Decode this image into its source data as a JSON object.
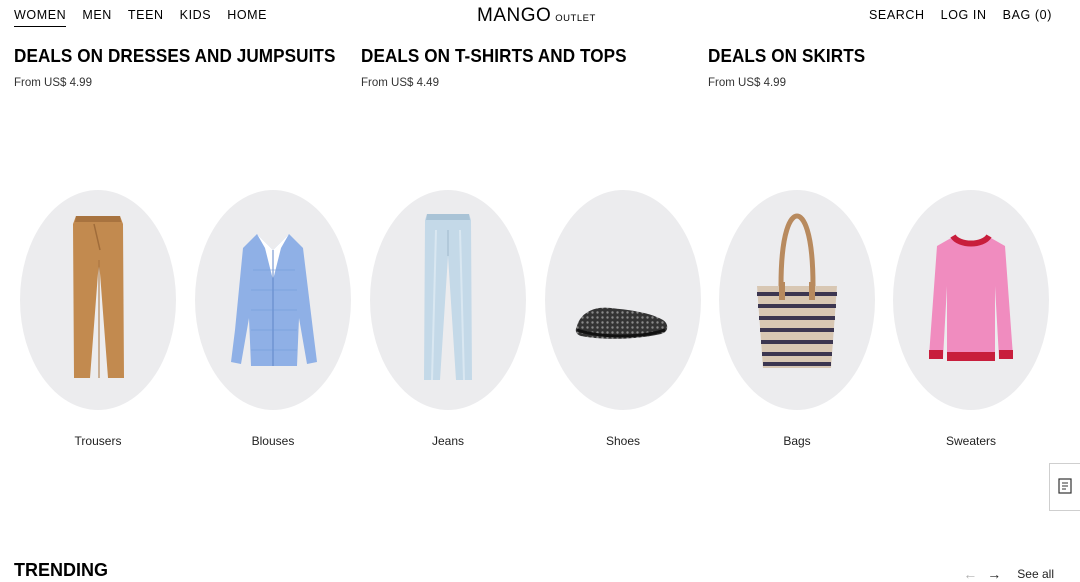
{
  "header": {
    "nav_left": [
      "WOMEN",
      "MEN",
      "TEEN",
      "KIDS",
      "HOME"
    ],
    "logo_main": "MANGO",
    "logo_sub": "OUTLET",
    "nav_right": [
      "SEARCH",
      "LOG IN",
      "BAG (0)"
    ]
  },
  "deals": [
    {
      "title": "DEALS ON DRESSES AND JUMPSUITS",
      "price": "From US$ 4.99"
    },
    {
      "title": "DEALS ON T-SHIRTS AND TOPS",
      "price": "From US$ 4.49"
    },
    {
      "title": "DEALS ON SKIRTS",
      "price": "From US$ 4.99"
    }
  ],
  "categories": [
    {
      "label": "Trousers",
      "icon": "trousers-icon"
    },
    {
      "label": "Blouses",
      "icon": "blouse-icon"
    },
    {
      "label": "Jeans",
      "icon": "jeans-icon"
    },
    {
      "label": "Shoes",
      "icon": "shoe-icon"
    },
    {
      "label": "Bags",
      "icon": "bag-icon"
    },
    {
      "label": "Sweaters",
      "icon": "sweater-icon"
    }
  ],
  "trending": {
    "title": "TRENDING",
    "prev": "←",
    "next": "→",
    "see_all": "See all"
  },
  "colors": {
    "circle_bg": "#ececee",
    "trousers": "#c28a4f",
    "blouse": "#8fb0e6",
    "jeans": "#c4d9e8",
    "sweater": "#f08cbf",
    "sweater_trim": "#c81e3c"
  }
}
